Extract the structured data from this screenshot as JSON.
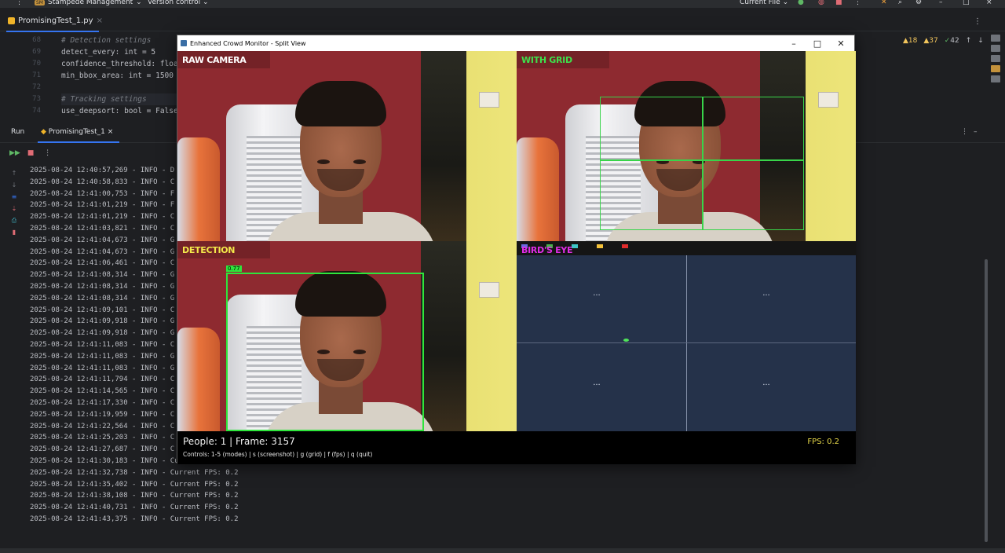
{
  "ide": {
    "project": "Stampede Management",
    "project_badge": "SM",
    "version_control": "Version control",
    "run_config": "Current File",
    "file_tab": "PromisingTest_1.py",
    "inspections": {
      "warnings_a": "18",
      "warnings_b": "37",
      "ok": "42"
    },
    "line_numbers": [
      "68",
      "69",
      "70",
      "71",
      "72",
      "73",
      "74"
    ],
    "code": [
      {
        "text": "# Detection settings",
        "kind": "comment"
      },
      {
        "text": "detect_every: int = 5",
        "kind": "code"
      },
      {
        "text": "confidence_threshold: float",
        "kind": "code"
      },
      {
        "text": "min_bbox_area: int = 1500",
        "kind": "code"
      },
      {
        "text": "",
        "kind": "code"
      },
      {
        "text": "# Tracking settings",
        "kind": "comment"
      },
      {
        "text": "use_deepsort: bool = False",
        "kind": "code"
      }
    ],
    "run_label": "Run",
    "run_tab": "PromisingTest_1"
  },
  "console_lines": [
    "2025-08-24 12:40:57,269 - INFO - D",
    "2025-08-24 12:40:58,833 - INFO - C",
    "2025-08-24 12:41:00,753 - INFO - F",
    "2025-08-24 12:41:01,219 - INFO - F",
    "2025-08-24 12:41:01,219 - INFO - C",
    "2025-08-24 12:41:03,821 - INFO - C",
    "2025-08-24 12:41:04,673 - INFO - G",
    "2025-08-24 12:41:04,673 - INFO - G",
    "2025-08-24 12:41:06,461 - INFO - C",
    "2025-08-24 12:41:08,314 - INFO - G",
    "2025-08-24 12:41:08,314 - INFO - G",
    "2025-08-24 12:41:08,314 - INFO - G",
    "2025-08-24 12:41:09,101 - INFO - C",
    "2025-08-24 12:41:09,918 - INFO - G",
    "2025-08-24 12:41:09,918 - INFO - G",
    "2025-08-24 12:41:11,083 - INFO - C",
    "2025-08-24 12:41:11,083 - INFO - G",
    "2025-08-24 12:41:11,083 - INFO - G",
    "2025-08-24 12:41:11,794 - INFO - C",
    "2025-08-24 12:41:14,565 - INFO - C",
    "2025-08-24 12:41:17,330 - INFO - C",
    "2025-08-24 12:41:19,959 - INFO - C",
    "2025-08-24 12:41:22,564 - INFO - C",
    "2025-08-24 12:41:25,203 - INFO - C",
    "2025-08-24 12:41:27,687 - INFO - C",
    "2025-08-24 12:41:30,183 - INFO - Current FPS: 0.2",
    "2025-08-24 12:41:32,738 - INFO - Current FPS: 0.2",
    "2025-08-24 12:41:35,402 - INFO - Current FPS: 0.2",
    "2025-08-24 12:41:38,108 - INFO - Current FPS: 0.2",
    "2025-08-24 12:41:40,731 - INFO - Current FPS: 0.2",
    "2025-08-24 12:41:43,375 - INFO - Current FPS: 0.2"
  ],
  "monitor": {
    "title": "Enhanced Crowd Monitor - Split View",
    "panels": {
      "raw": "RAW CAMERA",
      "grid": "WITH GRID",
      "detection": "DETECTION",
      "birdseye": "BIRD'S EYE"
    },
    "detection_tag": "0.77",
    "status_main": "People: 1 | Frame: 3157",
    "controls": "Controls: 1-5 (modes) | s (screenshot) | g (grid) | f (fps) | q (quit)",
    "fps": "FPS: 0.2",
    "colors": {
      "raw": "#ffffff",
      "grid": "#3ee04c",
      "detection": "#f3e84a",
      "birdseye": "#e02ce6"
    }
  }
}
